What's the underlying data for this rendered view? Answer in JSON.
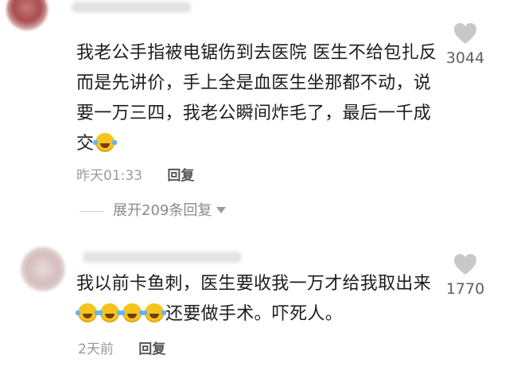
{
  "comments": [
    {
      "text": "我老公手指被电锯伤到去医院 医生不给包扎反而是先讲价，手上全是血医生坐那都不动，说要一万三四，我老公瞬间炸毛了，最后一千成交",
      "emoji_count": 1,
      "emoji_icon": "laugh-cry-emoji",
      "time": "昨天01:33",
      "reply_label": "回复",
      "likes": "3044"
    },
    {
      "text": "我以前卡鱼刺，医生要收我一万才给我取出来",
      "emoji_count": 4,
      "emoji_icon": "laugh-cry-emoji",
      "text_after": "还要做手术。吓死人。",
      "time": "2天前",
      "reply_label": "回复",
      "likes": "1770"
    }
  ],
  "expand_replies": "展开209条回复",
  "colors": {
    "meta": "#9a9a9a",
    "heart": "#c8c8c8",
    "emoji": "#f5c51e"
  }
}
